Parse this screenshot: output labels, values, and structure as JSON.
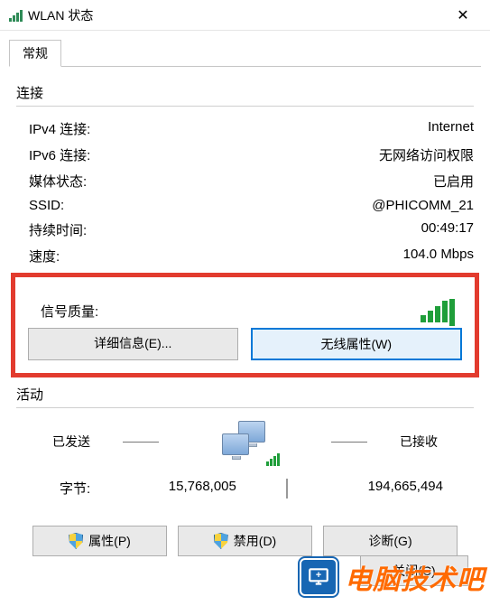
{
  "window": {
    "title": "WLAN 状态"
  },
  "tab": {
    "general": "常规"
  },
  "connection": {
    "section": "连接",
    "ipv4_label": "IPv4 连接:",
    "ipv4_value": "Internet",
    "ipv6_label": "IPv6 连接:",
    "ipv6_value": "无网络访问权限",
    "media_label": "媒体状态:",
    "media_value": "已启用",
    "ssid_label": "SSID:",
    "ssid_value": "@PHICOMM_21",
    "duration_label": "持续时间:",
    "duration_value": "00:49:17",
    "speed_label": "速度:",
    "speed_value": "104.0 Mbps",
    "signal_label": "信号质量:"
  },
  "buttons": {
    "details": "详细信息(E)...",
    "wireless_props": "无线属性(W)",
    "properties": "属性(P)",
    "disable": "禁用(D)",
    "diagnose": "诊断(G)",
    "close": "关闭(C)"
  },
  "activity": {
    "section": "活动",
    "sent_label": "已发送",
    "recv_label": "已接收",
    "bytes_label": "字节:",
    "bytes_sent": "15,768,005",
    "bytes_recv": "194,665,494"
  },
  "watermark": {
    "text": "电脑技术吧"
  }
}
